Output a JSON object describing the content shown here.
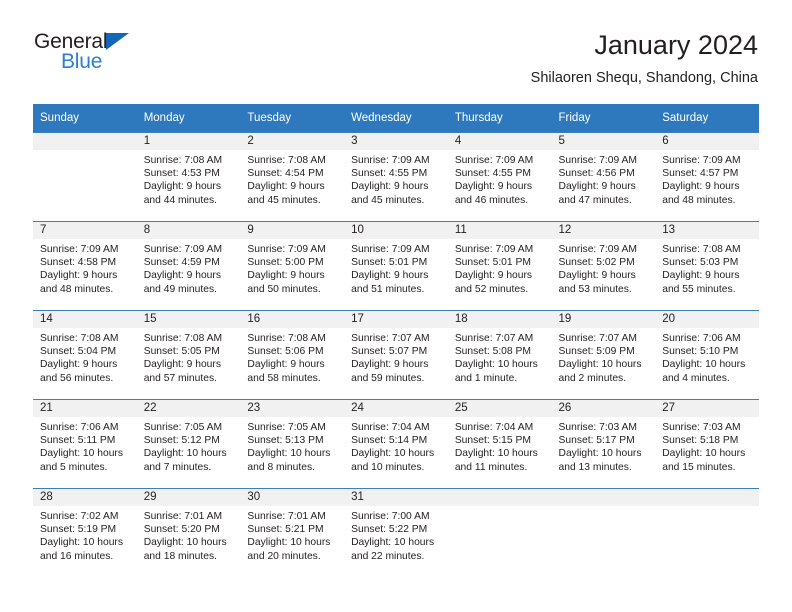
{
  "brand": {
    "name_part1": "General",
    "name_part2": "Blue",
    "triangle_color": "#1565b8",
    "blue_color": "#2a7fd4"
  },
  "header": {
    "title": "January 2024",
    "subtitle": "Shilaoren Shequ, Shandong, China"
  },
  "theme": {
    "header_bg": "#2e79bd",
    "daynum_bg": "#f1f1f1",
    "row_divider": "#3d7fbe",
    "text": "#231f20"
  },
  "weekday_headers": [
    "Sunday",
    "Monday",
    "Tuesday",
    "Wednesday",
    "Thursday",
    "Friday",
    "Saturday"
  ],
  "weeks": [
    [
      {
        "day": "",
        "sunrise": "",
        "sunset": "",
        "daylight_line1": "",
        "daylight_line2": ""
      },
      {
        "day": "1",
        "sunrise": "Sunrise: 7:08 AM",
        "sunset": "Sunset: 4:53 PM",
        "daylight_line1": "Daylight: 9 hours",
        "daylight_line2": "and 44 minutes."
      },
      {
        "day": "2",
        "sunrise": "Sunrise: 7:08 AM",
        "sunset": "Sunset: 4:54 PM",
        "daylight_line1": "Daylight: 9 hours",
        "daylight_line2": "and 45 minutes."
      },
      {
        "day": "3",
        "sunrise": "Sunrise: 7:09 AM",
        "sunset": "Sunset: 4:55 PM",
        "daylight_line1": "Daylight: 9 hours",
        "daylight_line2": "and 45 minutes."
      },
      {
        "day": "4",
        "sunrise": "Sunrise: 7:09 AM",
        "sunset": "Sunset: 4:55 PM",
        "daylight_line1": "Daylight: 9 hours",
        "daylight_line2": "and 46 minutes."
      },
      {
        "day": "5",
        "sunrise": "Sunrise: 7:09 AM",
        "sunset": "Sunset: 4:56 PM",
        "daylight_line1": "Daylight: 9 hours",
        "daylight_line2": "and 47 minutes."
      },
      {
        "day": "6",
        "sunrise": "Sunrise: 7:09 AM",
        "sunset": "Sunset: 4:57 PM",
        "daylight_line1": "Daylight: 9 hours",
        "daylight_line2": "and 48 minutes."
      }
    ],
    [
      {
        "day": "7",
        "sunrise": "Sunrise: 7:09 AM",
        "sunset": "Sunset: 4:58 PM",
        "daylight_line1": "Daylight: 9 hours",
        "daylight_line2": "and 48 minutes."
      },
      {
        "day": "8",
        "sunrise": "Sunrise: 7:09 AM",
        "sunset": "Sunset: 4:59 PM",
        "daylight_line1": "Daylight: 9 hours",
        "daylight_line2": "and 49 minutes."
      },
      {
        "day": "9",
        "sunrise": "Sunrise: 7:09 AM",
        "sunset": "Sunset: 5:00 PM",
        "daylight_line1": "Daylight: 9 hours",
        "daylight_line2": "and 50 minutes."
      },
      {
        "day": "10",
        "sunrise": "Sunrise: 7:09 AM",
        "sunset": "Sunset: 5:01 PM",
        "daylight_line1": "Daylight: 9 hours",
        "daylight_line2": "and 51 minutes."
      },
      {
        "day": "11",
        "sunrise": "Sunrise: 7:09 AM",
        "sunset": "Sunset: 5:01 PM",
        "daylight_line1": "Daylight: 9 hours",
        "daylight_line2": "and 52 minutes."
      },
      {
        "day": "12",
        "sunrise": "Sunrise: 7:09 AM",
        "sunset": "Sunset: 5:02 PM",
        "daylight_line1": "Daylight: 9 hours",
        "daylight_line2": "and 53 minutes."
      },
      {
        "day": "13",
        "sunrise": "Sunrise: 7:08 AM",
        "sunset": "Sunset: 5:03 PM",
        "daylight_line1": "Daylight: 9 hours",
        "daylight_line2": "and 55 minutes."
      }
    ],
    [
      {
        "day": "14",
        "sunrise": "Sunrise: 7:08 AM",
        "sunset": "Sunset: 5:04 PM",
        "daylight_line1": "Daylight: 9 hours",
        "daylight_line2": "and 56 minutes."
      },
      {
        "day": "15",
        "sunrise": "Sunrise: 7:08 AM",
        "sunset": "Sunset: 5:05 PM",
        "daylight_line1": "Daylight: 9 hours",
        "daylight_line2": "and 57 minutes."
      },
      {
        "day": "16",
        "sunrise": "Sunrise: 7:08 AM",
        "sunset": "Sunset: 5:06 PM",
        "daylight_line1": "Daylight: 9 hours",
        "daylight_line2": "and 58 minutes."
      },
      {
        "day": "17",
        "sunrise": "Sunrise: 7:07 AM",
        "sunset": "Sunset: 5:07 PM",
        "daylight_line1": "Daylight: 9 hours",
        "daylight_line2": "and 59 minutes."
      },
      {
        "day": "18",
        "sunrise": "Sunrise: 7:07 AM",
        "sunset": "Sunset: 5:08 PM",
        "daylight_line1": "Daylight: 10 hours",
        "daylight_line2": "and 1 minute."
      },
      {
        "day": "19",
        "sunrise": "Sunrise: 7:07 AM",
        "sunset": "Sunset: 5:09 PM",
        "daylight_line1": "Daylight: 10 hours",
        "daylight_line2": "and 2 minutes."
      },
      {
        "day": "20",
        "sunrise": "Sunrise: 7:06 AM",
        "sunset": "Sunset: 5:10 PM",
        "daylight_line1": "Daylight: 10 hours",
        "daylight_line2": "and 4 minutes."
      }
    ],
    [
      {
        "day": "21",
        "sunrise": "Sunrise: 7:06 AM",
        "sunset": "Sunset: 5:11 PM",
        "daylight_line1": "Daylight: 10 hours",
        "daylight_line2": "and 5 minutes."
      },
      {
        "day": "22",
        "sunrise": "Sunrise: 7:05 AM",
        "sunset": "Sunset: 5:12 PM",
        "daylight_line1": "Daylight: 10 hours",
        "daylight_line2": "and 7 minutes."
      },
      {
        "day": "23",
        "sunrise": "Sunrise: 7:05 AM",
        "sunset": "Sunset: 5:13 PM",
        "daylight_line1": "Daylight: 10 hours",
        "daylight_line2": "and 8 minutes."
      },
      {
        "day": "24",
        "sunrise": "Sunrise: 7:04 AM",
        "sunset": "Sunset: 5:14 PM",
        "daylight_line1": "Daylight: 10 hours",
        "daylight_line2": "and 10 minutes."
      },
      {
        "day": "25",
        "sunrise": "Sunrise: 7:04 AM",
        "sunset": "Sunset: 5:15 PM",
        "daylight_line1": "Daylight: 10 hours",
        "daylight_line2": "and 11 minutes."
      },
      {
        "day": "26",
        "sunrise": "Sunrise: 7:03 AM",
        "sunset": "Sunset: 5:17 PM",
        "daylight_line1": "Daylight: 10 hours",
        "daylight_line2": "and 13 minutes."
      },
      {
        "day": "27",
        "sunrise": "Sunrise: 7:03 AM",
        "sunset": "Sunset: 5:18 PM",
        "daylight_line1": "Daylight: 10 hours",
        "daylight_line2": "and 15 minutes."
      }
    ],
    [
      {
        "day": "28",
        "sunrise": "Sunrise: 7:02 AM",
        "sunset": "Sunset: 5:19 PM",
        "daylight_line1": "Daylight: 10 hours",
        "daylight_line2": "and 16 minutes."
      },
      {
        "day": "29",
        "sunrise": "Sunrise: 7:01 AM",
        "sunset": "Sunset: 5:20 PM",
        "daylight_line1": "Daylight: 10 hours",
        "daylight_line2": "and 18 minutes."
      },
      {
        "day": "30",
        "sunrise": "Sunrise: 7:01 AM",
        "sunset": "Sunset: 5:21 PM",
        "daylight_line1": "Daylight: 10 hours",
        "daylight_line2": "and 20 minutes."
      },
      {
        "day": "31",
        "sunrise": "Sunrise: 7:00 AM",
        "sunset": "Sunset: 5:22 PM",
        "daylight_line1": "Daylight: 10 hours",
        "daylight_line2": "and 22 minutes."
      },
      {
        "day": "",
        "sunrise": "",
        "sunset": "",
        "daylight_line1": "",
        "daylight_line2": ""
      },
      {
        "day": "",
        "sunrise": "",
        "sunset": "",
        "daylight_line1": "",
        "daylight_line2": ""
      },
      {
        "day": "",
        "sunrise": "",
        "sunset": "",
        "daylight_line1": "",
        "daylight_line2": ""
      }
    ]
  ]
}
